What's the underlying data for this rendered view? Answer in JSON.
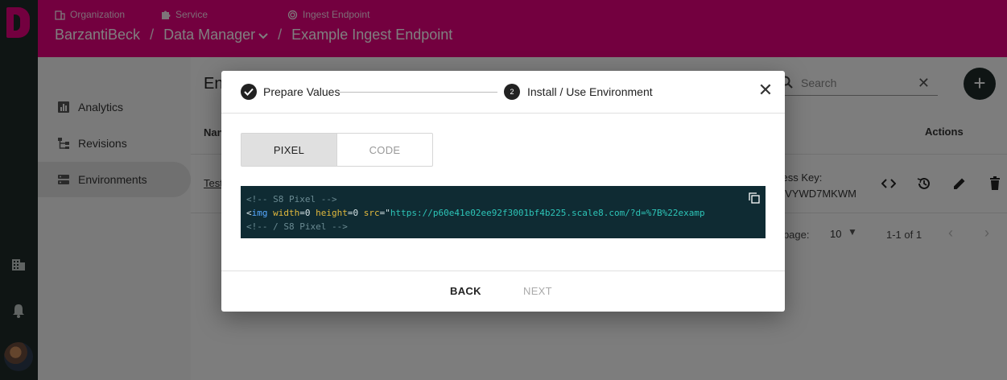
{
  "header": {
    "crumb_labels": {
      "organization": "Organization",
      "service": "Service",
      "ingest_endpoint": "Ingest Endpoint"
    },
    "organization": "BarzantiBeck",
    "separator": "/",
    "service": "Data Manager",
    "endpoint": "Example Ingest Endpoint"
  },
  "sidebar": {
    "items": [
      {
        "label": "Analytics",
        "icon": "bar-chart-icon"
      },
      {
        "label": "Revisions",
        "icon": "tree-icon"
      },
      {
        "label": "Environments",
        "icon": "server-icon",
        "active": true
      }
    ]
  },
  "main": {
    "title": "En",
    "search_placeholder": "Search",
    "columns": {
      "name": "Nan",
      "actions": "Actions"
    },
    "row": {
      "name": "Test",
      "access_key_label": "cess Key:",
      "access_key_value": "QVYWD7MKWM"
    },
    "pagination": {
      "rows_per_page_label": "r page:",
      "rows_per_page": "10",
      "range": "1-1 of 1"
    }
  },
  "dialog": {
    "step1_label": "Prepare Values",
    "step2_number": "2",
    "step2_label": "Install / Use Environment",
    "toggle": {
      "pixel": "PIXEL",
      "code": "CODE"
    },
    "code": {
      "line1": "<!-- S8 Pixel -->",
      "line2_open": "<",
      "line2_tag": "img",
      "line2_attr1": "width",
      "line2_val1": "=0 ",
      "line2_attr2": "height",
      "line2_val2": "=0 ",
      "line2_attr3": "src",
      "line2_eq": "=\"",
      "line2_url": "https://p60e41e02ee92f3001bf4b225.scale8.com/?d=%7B%22examp",
      "line3": "<!-- / S8 Pixel -->"
    },
    "back_label": "BACK",
    "next_label": "NEXT"
  },
  "colors": {
    "brand": "#e6007e",
    "rail": "#1f2a28",
    "code_bg": "#0f2b33"
  }
}
